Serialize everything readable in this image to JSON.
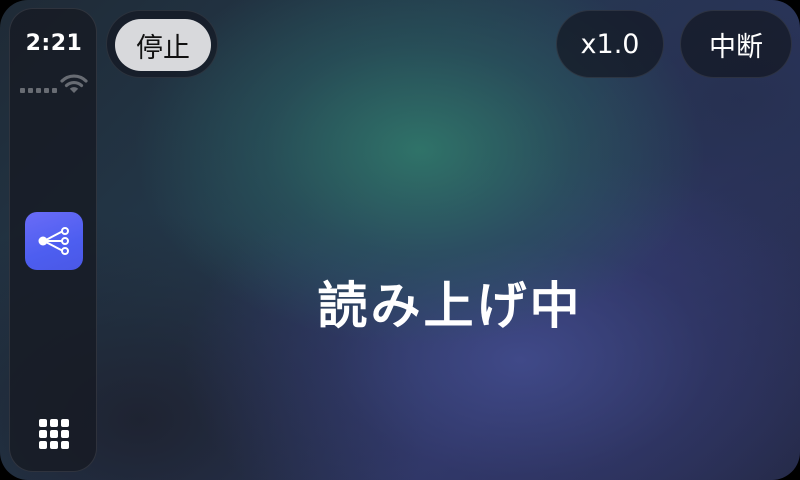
{
  "status_bar": {
    "time": "2:21"
  },
  "sidebar": {
    "app_icon": "share-nodes-icon",
    "launcher_icon": "app-grid-icon"
  },
  "controls": {
    "stop_label": "停止",
    "speed_label": "x1.0",
    "pause_label": "中断"
  },
  "main": {
    "status_text": "読み上げ中"
  },
  "colors": {
    "app_icon_accent": "#5563f0",
    "stop_button_bg": "#d8d9dc",
    "pill_bg": "#161a24"
  }
}
